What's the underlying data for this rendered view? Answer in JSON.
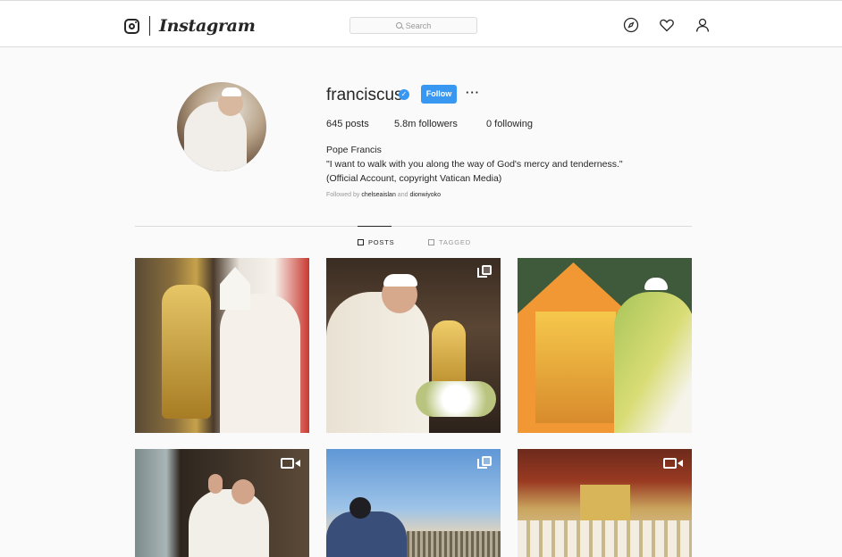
{
  "header": {
    "wordmark": "Instagram",
    "search_placeholder": "Search",
    "icons": [
      "compass-icon",
      "heart-icon",
      "user-icon"
    ]
  },
  "profile": {
    "username": "franciscus",
    "verified": true,
    "follow_label": "Follow",
    "more_label": "···",
    "stats": {
      "posts": "645 posts",
      "followers": "5.8m followers",
      "following": "0 following"
    },
    "bio": {
      "name": "Pope Francis",
      "line1": "\"I want to walk with you along the way of God's mercy and tenderness.\"",
      "line2": "(Official Account, copyright Vatican Media)"
    },
    "followed_by": {
      "prefix": "Followed by",
      "user1": "chelseaislan",
      "joiner": "and",
      "user2": "dionwiyoko"
    }
  },
  "tabs": {
    "posts": "POSTS",
    "tagged": "TAGGED"
  },
  "posts": [
    {
      "badge": "none"
    },
    {
      "badge": "multiple"
    },
    {
      "badge": "none"
    },
    {
      "badge": "video"
    },
    {
      "badge": "multiple"
    },
    {
      "badge": "video"
    }
  ],
  "colors": {
    "accent": "#3897f0",
    "border": "#dbdbdb",
    "background": "#fafafa"
  }
}
